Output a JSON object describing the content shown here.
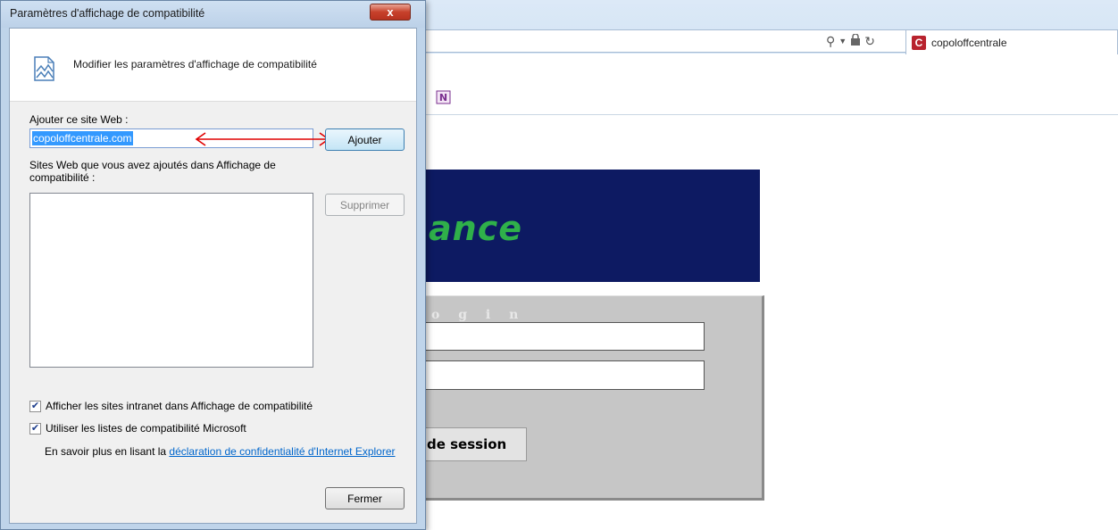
{
  "browser": {
    "tab_title": "copoloffcentrale",
    "tab_favicon_letter": "C",
    "toolbar_icon_letter": "N"
  },
  "page": {
    "banner_text": "ance",
    "login_label": "o g i n",
    "session_button_text": "de session"
  },
  "dialog": {
    "title": "Paramètres d'affichage de compatibilité",
    "close_glyph": "x",
    "header_text": "Modifier les paramètres d'affichage de compatibilité",
    "add_site_label": "Ajouter ce site Web :",
    "site_input_value": "copoloffcentrale.com",
    "add_button": "Ajouter",
    "list_label": "Sites Web que vous avez ajoutés dans Affichage de compatibilité :",
    "remove_button": "Supprimer",
    "checkbox_intranet": "Afficher les sites intranet dans Affichage de compatibilité",
    "checkbox_intranet_checked": true,
    "checkbox_microsoft": "Utiliser les listes de compatibilité Microsoft",
    "checkbox_microsoft_checked": true,
    "privacy_prefix": "En savoir plus en lisant la ",
    "privacy_link": "déclaration de confidentialité d'Internet Explorer",
    "close_button": "Fermer"
  },
  "colors": {
    "selection": "#3399ff",
    "arrow": "#e00000",
    "banner": "#0d1a62",
    "banner_text": "#2fb04a"
  }
}
